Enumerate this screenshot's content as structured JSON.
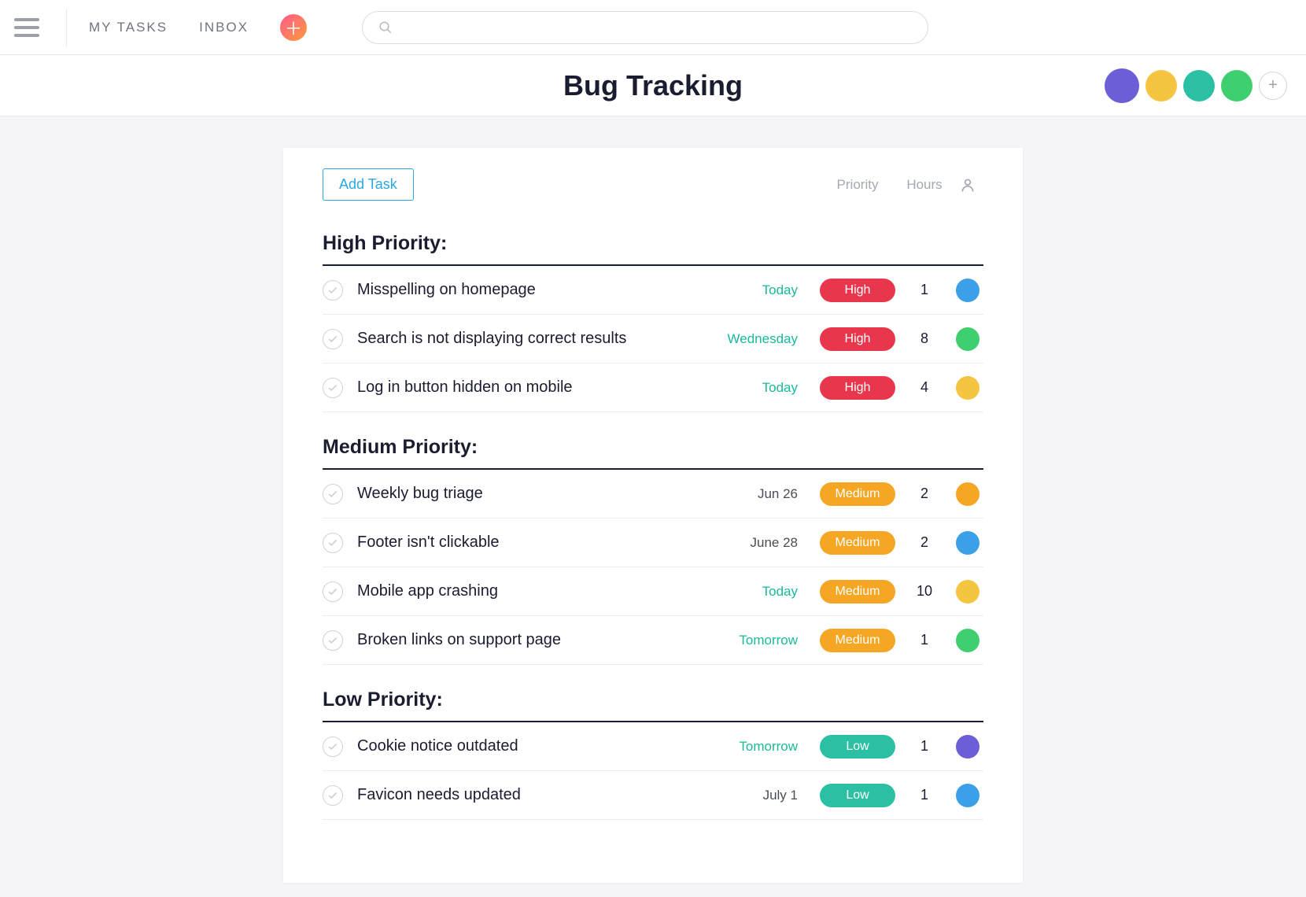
{
  "nav": {
    "mytasks": "MY TASKS",
    "inbox": "INBOX"
  },
  "search": {
    "placeholder": ""
  },
  "page_title": "Bug Tracking",
  "team_avatars": [
    {
      "color": "c-purple",
      "big": true
    },
    {
      "color": "c-yellow"
    },
    {
      "color": "c-teal"
    },
    {
      "color": "c-green"
    }
  ],
  "add_task_label": "Add Task",
  "columns": {
    "priority": "Priority",
    "hours": "Hours"
  },
  "groups": [
    {
      "title": "High Priority:",
      "tasks": [
        {
          "name": "Misspelling on homepage",
          "due": "Today",
          "soon": true,
          "priority": "High",
          "hours": "1",
          "avatar_color": "c-blue"
        },
        {
          "name": "Search is not displaying correct results",
          "due": "Wednesday",
          "soon": true,
          "priority": "High",
          "hours": "8",
          "avatar_color": "c-green"
        },
        {
          "name": "Log in button hidden on mobile",
          "due": "Today",
          "soon": true,
          "priority": "High",
          "hours": "4",
          "avatar_color": "c-yellow"
        }
      ]
    },
    {
      "title": "Medium Priority:",
      "tasks": [
        {
          "name": "Weekly bug triage",
          "due": "Jun 26",
          "soon": false,
          "priority": "Medium",
          "hours": "2",
          "avatar_color": "c-orange"
        },
        {
          "name": "Footer isn't clickable",
          "due": "June 28",
          "soon": false,
          "priority": "Medium",
          "hours": "2",
          "avatar_color": "c-blue"
        },
        {
          "name": "Mobile app crashing",
          "due": "Today",
          "soon": true,
          "priority": "Medium",
          "hours": "10",
          "avatar_color": "c-yellow"
        },
        {
          "name": "Broken links on support page",
          "due": "Tomorrow",
          "soon": true,
          "priority": "Medium",
          "hours": "1",
          "avatar_color": "c-green"
        }
      ]
    },
    {
      "title": "Low Priority:",
      "tasks": [
        {
          "name": "Cookie notice outdated",
          "due": "Tomorrow",
          "soon": true,
          "priority": "Low",
          "hours": "1",
          "avatar_color": "c-purple"
        },
        {
          "name": "Favicon needs updated",
          "due": "July 1",
          "soon": false,
          "priority": "Low",
          "hours": "1",
          "avatar_color": "c-blue"
        }
      ]
    }
  ]
}
